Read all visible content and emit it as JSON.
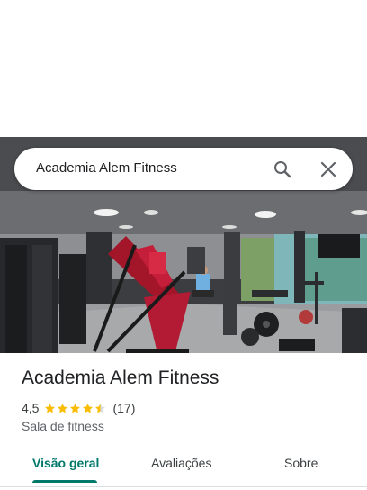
{
  "search": {
    "query": "Academia Alem Fitness"
  },
  "icons": {
    "search": "search-icon",
    "close": "close-icon",
    "star": "star-icon"
  },
  "place": {
    "name": "Academia Alem Fitness",
    "rating_text": "4,5",
    "rating_value": 4.5,
    "rating_max": 5,
    "review_count": "(17)",
    "category": "Sala de fitness"
  },
  "tabs": [
    {
      "label": "Visão geral",
      "active": true
    },
    {
      "label": "Avaliações",
      "active": false
    },
    {
      "label": "Sobre",
      "active": false
    }
  ],
  "colors": {
    "accent": "#00796b",
    "star": "#fbbc04",
    "star_empty": "#dadce0"
  }
}
